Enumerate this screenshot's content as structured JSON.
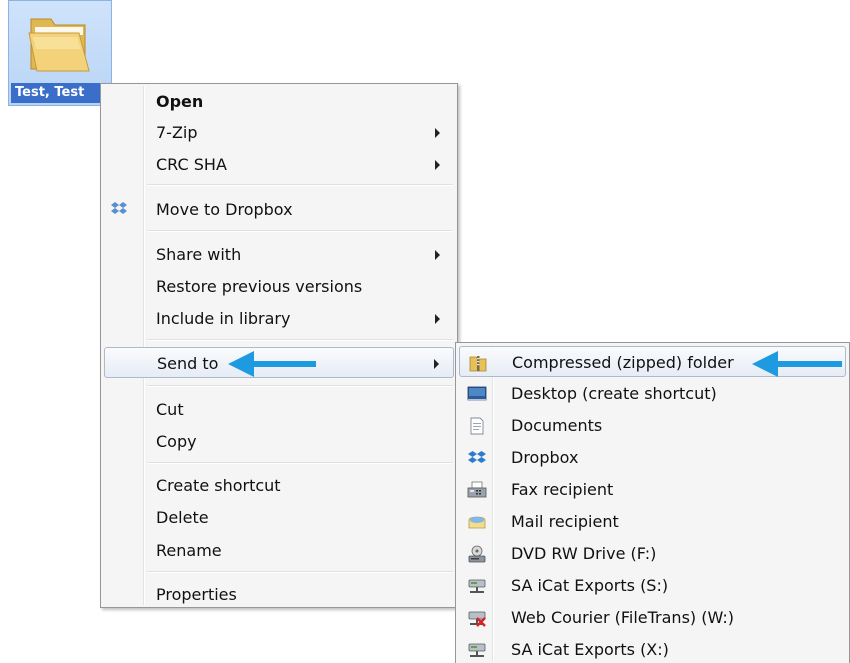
{
  "desktop": {
    "folder_label": "Test, Test"
  },
  "context_menu": {
    "items": [
      {
        "label": "Open",
        "bold": true,
        "submenu": false
      },
      {
        "label": "7-Zip",
        "submenu": true
      },
      {
        "label": "CRC SHA",
        "submenu": true
      },
      {
        "label": "Move to Dropbox",
        "submenu": false,
        "icon": "dropbox-icon"
      },
      {
        "label": "Share with",
        "submenu": true
      },
      {
        "label": "Restore previous versions",
        "submenu": false
      },
      {
        "label": "Include in library",
        "submenu": true
      },
      {
        "label": "Send to",
        "submenu": true,
        "highlighted": true
      },
      {
        "label": "Cut",
        "submenu": false
      },
      {
        "label": "Copy",
        "submenu": false
      },
      {
        "label": "Create shortcut",
        "submenu": false
      },
      {
        "label": "Delete",
        "submenu": false
      },
      {
        "label": "Rename",
        "submenu": false
      },
      {
        "label": "Properties",
        "submenu": false
      }
    ]
  },
  "send_to_menu": {
    "items": [
      {
        "label": "Compressed (zipped) folder",
        "icon": "zip-folder-icon",
        "highlighted": true
      },
      {
        "label": "Desktop (create shortcut)",
        "icon": "desktop-icon"
      },
      {
        "label": "Documents",
        "icon": "documents-icon"
      },
      {
        "label": "Dropbox",
        "icon": "dropbox-icon"
      },
      {
        "label": "Fax recipient",
        "icon": "fax-icon"
      },
      {
        "label": "Mail recipient",
        "icon": "mail-icon"
      },
      {
        "label": "DVD RW Drive (F:)",
        "icon": "dvd-drive-icon"
      },
      {
        "label": "SA iCat Exports (S:)",
        "icon": "network-drive-icon"
      },
      {
        "label": "Web Courier (FileTrans) (W:)",
        "icon": "disconnected-drive-icon"
      },
      {
        "label": "SA iCat Exports (X:)",
        "icon": "network-drive-icon"
      }
    ]
  },
  "colors": {
    "annotation_arrow": "#1e9be0",
    "selection_label_bg": "#3a6ec9"
  }
}
